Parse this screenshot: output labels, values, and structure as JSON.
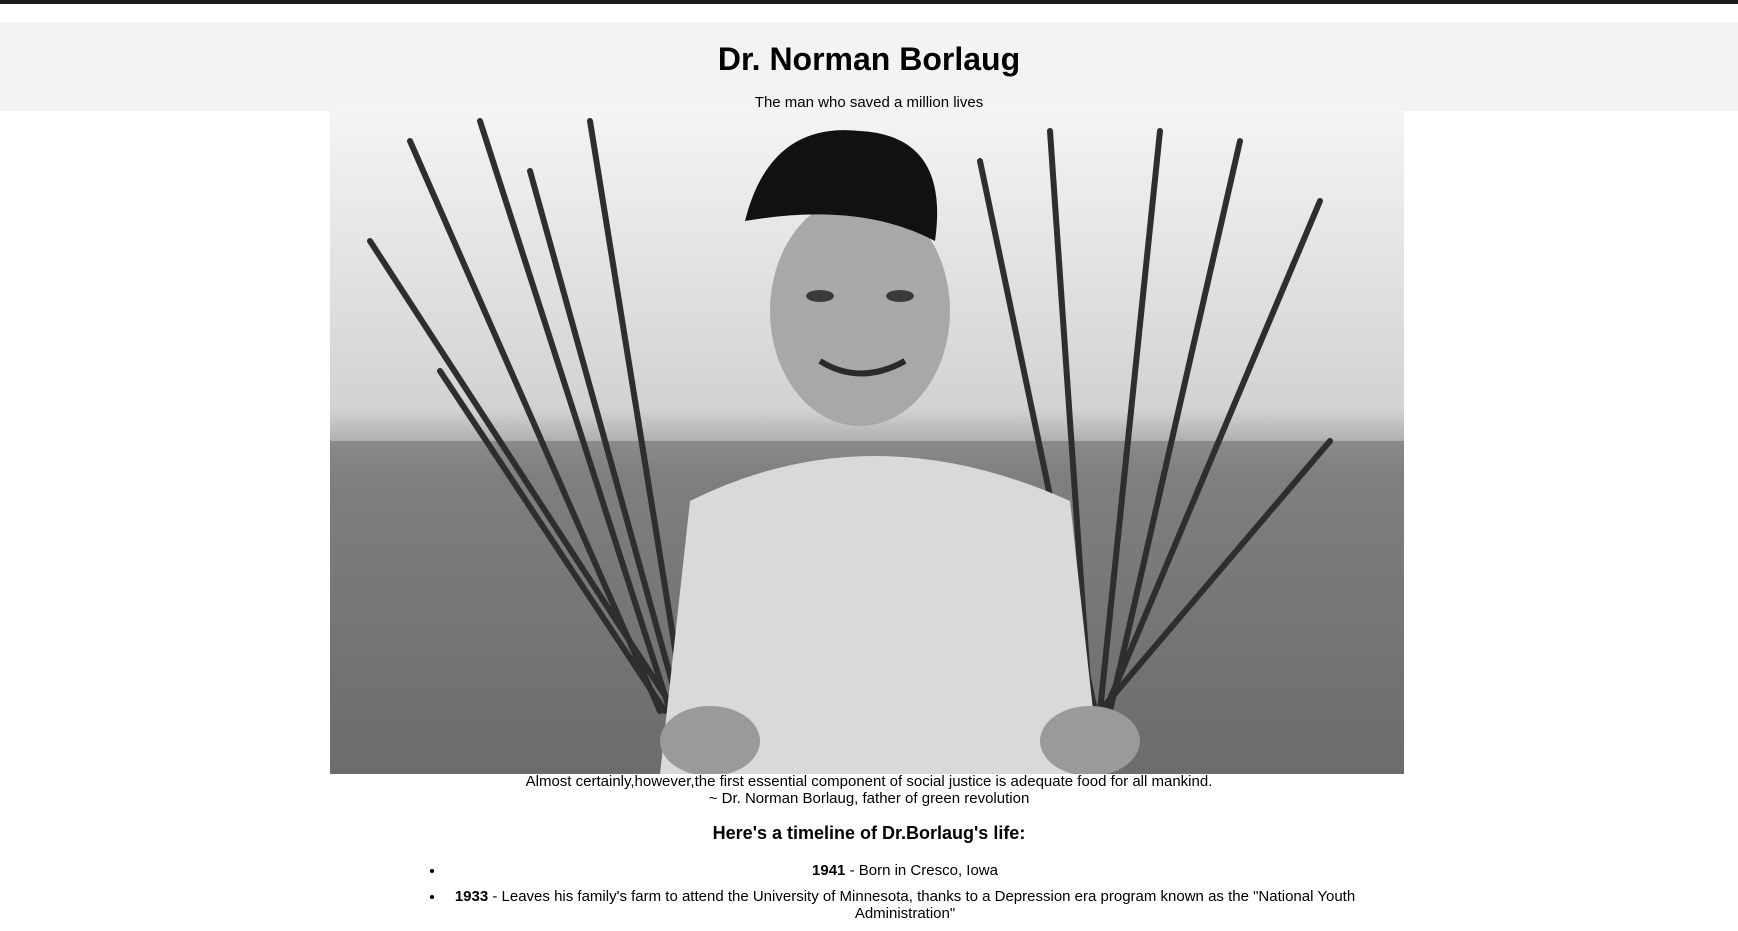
{
  "header": {
    "title": "Dr. Norman Borlaug",
    "subtitle": "The man who saved a million lives"
  },
  "photo": {
    "icon": "portrait-photo-wheat-field"
  },
  "quote": {
    "text": "Almost certainly,however,the first essential component of social justice is adequate food for all mankind.",
    "attribution": "~ Dr. Norman Borlaug, father of green revolution"
  },
  "timeline": {
    "title": "Here's a timeline of Dr.Borlaug's life:",
    "items": [
      {
        "year": "1941",
        "text": " - Born in Cresco, Iowa"
      },
      {
        "year": "1933",
        "text": " - Leaves his family's farm to attend the University of Minnesota, thanks to a Depression era program known as the \"National Youth Administration\""
      }
    ]
  }
}
